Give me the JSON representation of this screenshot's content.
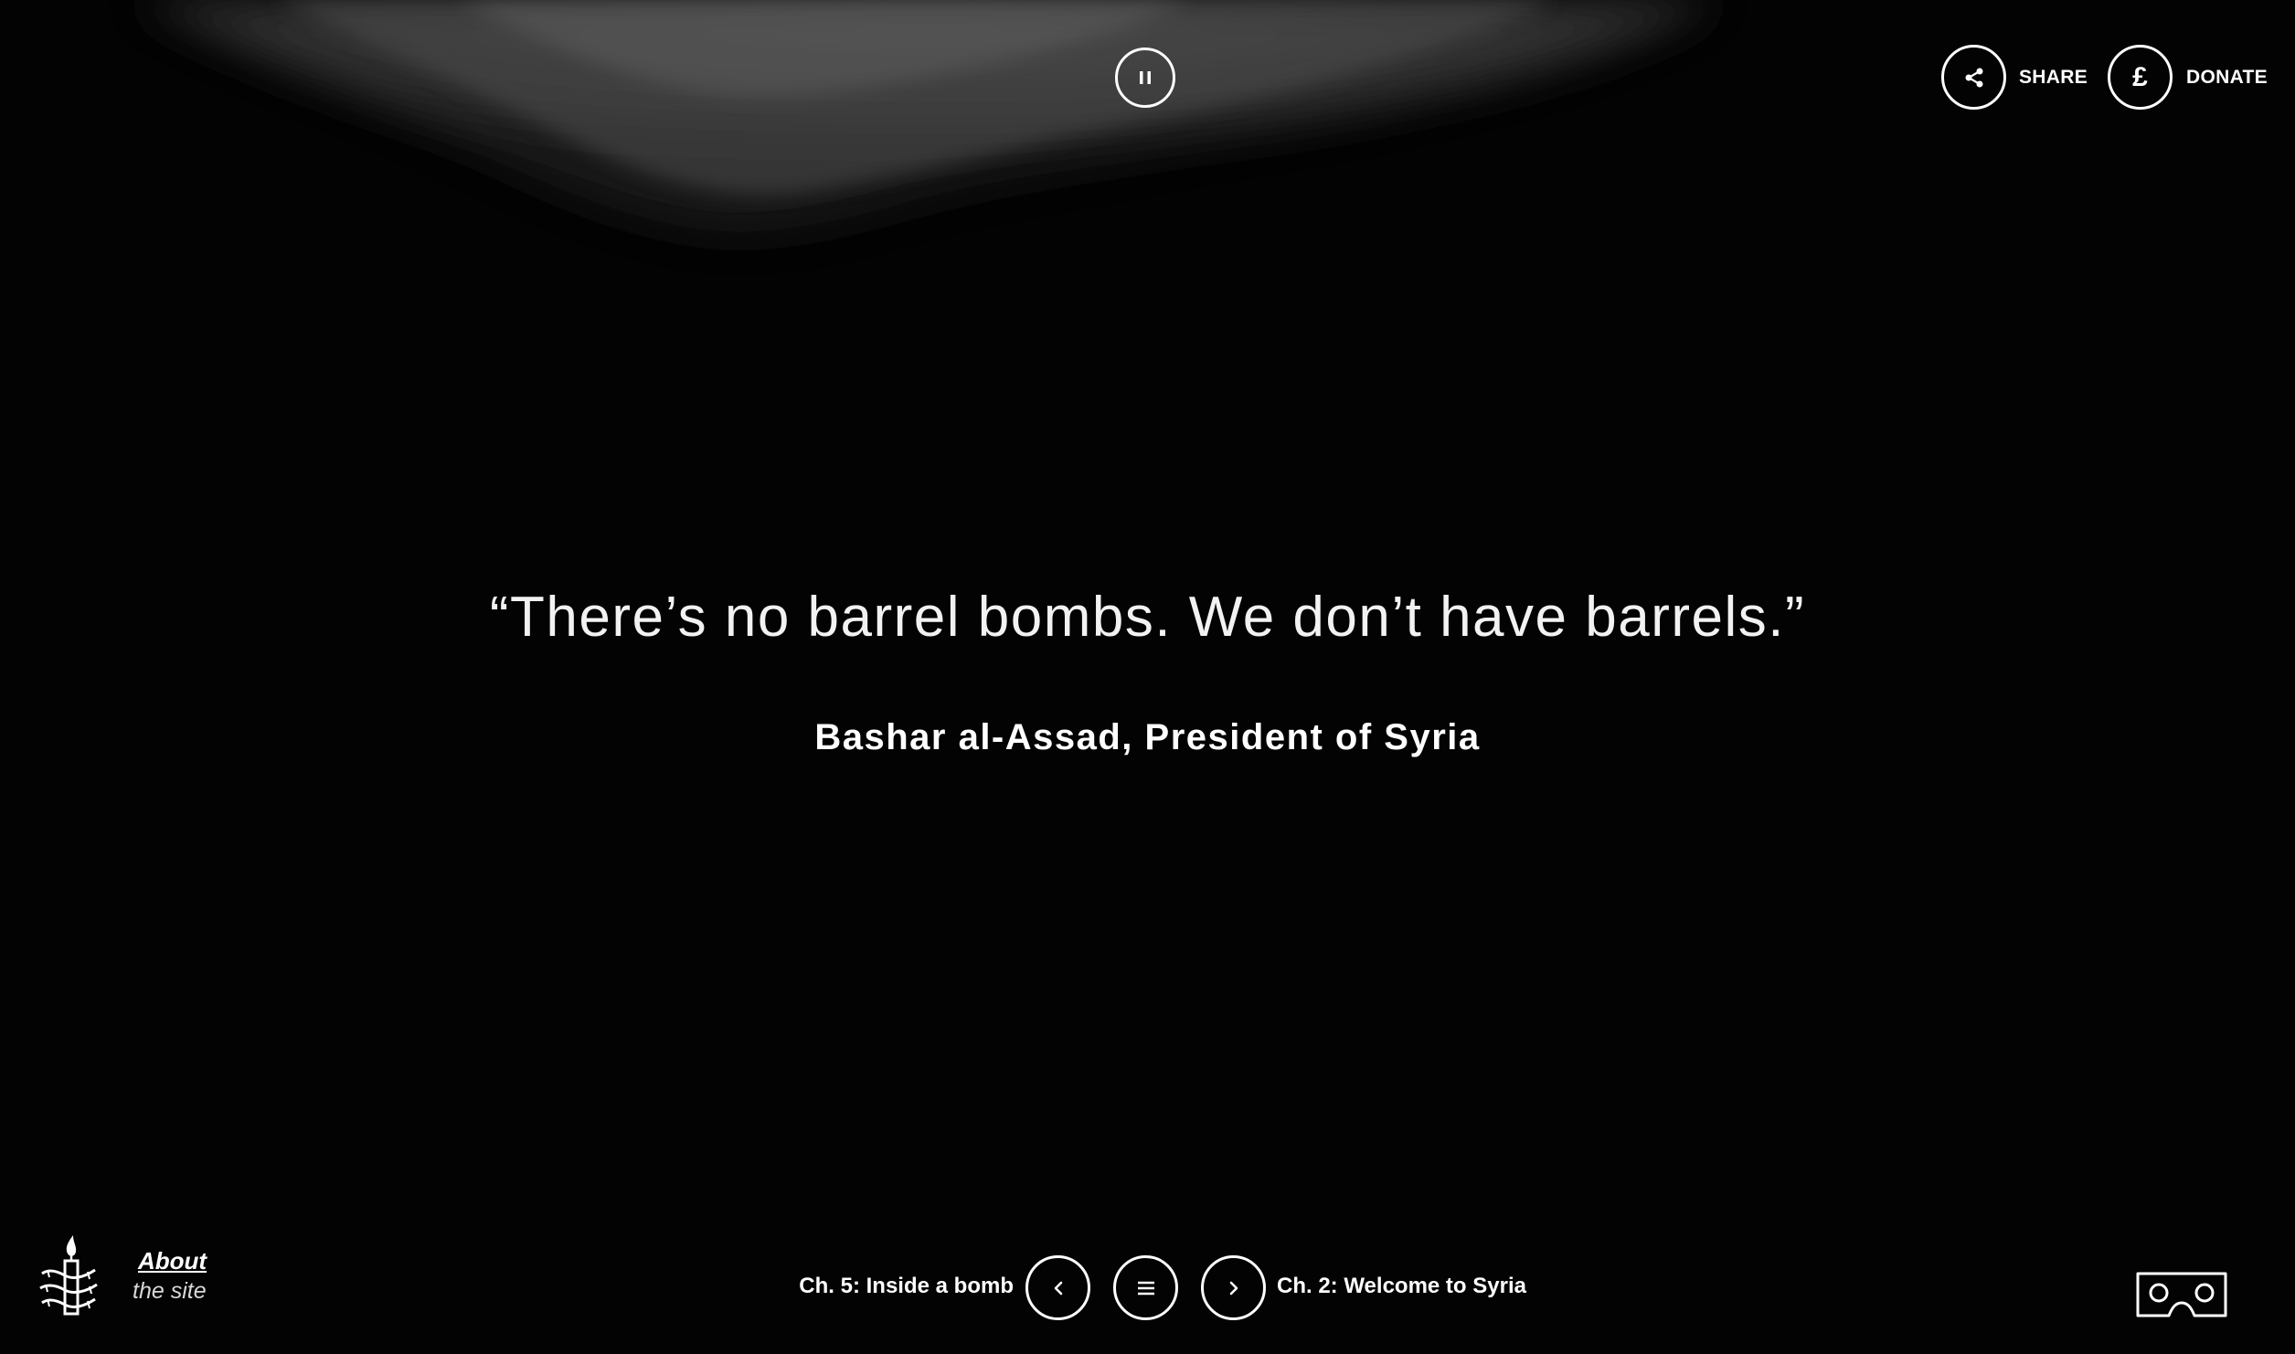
{
  "top_bar": {
    "pause_icon": "pause-icon",
    "share_label": "SHARE",
    "share_icon": "share-icon",
    "donate_label": "DONATE",
    "donate_symbol": "£"
  },
  "main": {
    "quote": "“There’s no barrel bombs. We don’t have barrels.”",
    "attribution": "Bashar al-Assad, President of Syria"
  },
  "footer": {
    "about_title": "About",
    "about_subtitle": "the site",
    "logo_icon": "amnesty-candle-logo",
    "prev_chapter_label": "Ch. 5: Inside a bomb",
    "next_chapter_label": "Ch. 2: Welcome to Syria",
    "prev_icon": "chevron-left-icon",
    "menu_icon": "menu-icon",
    "next_icon": "chevron-right-icon",
    "vr_icon": "vr-headset-icon"
  },
  "colors": {
    "background": "#030303",
    "foreground": "#ffffff",
    "smoke": "#4a4a4a"
  }
}
